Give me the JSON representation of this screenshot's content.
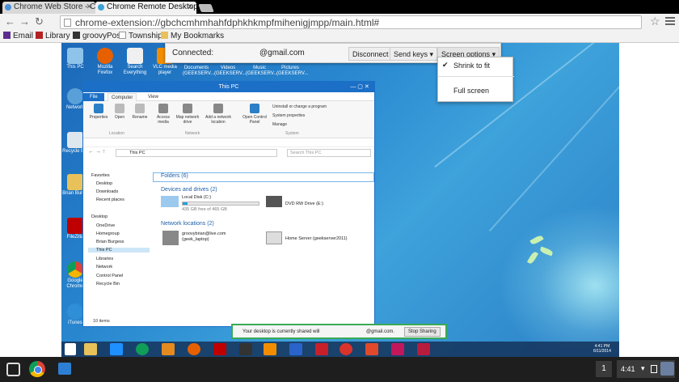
{
  "tabs": [
    {
      "title": "Chrome Web Store - Chr"
    },
    {
      "title": "Chrome Remote Desktop"
    }
  ],
  "address": {
    "url": "chrome-extension://gbchcmhmhahfdphkhkmpfmihenigjmpp/main.html#"
  },
  "bookmarks": [
    {
      "label": "Email"
    },
    {
      "label": "Library"
    },
    {
      "label": "groovyPost"
    },
    {
      "label": "Township"
    },
    {
      "label": "My Bookmarks"
    }
  ],
  "connect_bar": {
    "connected_label": "Connected:",
    "email": "@gmail.com",
    "disconnect": "Disconnect",
    "send_keys": "Send keys",
    "screen_options": "Screen options"
  },
  "screen_menu": {
    "shrink": "Shrink to fit",
    "full": "Full screen"
  },
  "desktop_icons": [
    {
      "label": "This PC"
    },
    {
      "label": "Mozilla Firefox"
    },
    {
      "label": "Search Everything"
    },
    {
      "label": "VLC media player"
    },
    {
      "label": "Documents (GEEKSERV..."
    },
    {
      "label": "Videos (GEEKSERV..."
    },
    {
      "label": "Music (GEEKSERV..."
    },
    {
      "label": "Pictures (GEEKSERV..."
    },
    {
      "label": "Network"
    },
    {
      "label": "Recycle Bin"
    },
    {
      "label": "Brian Burge"
    },
    {
      "label": "FileZilla"
    },
    {
      "label": "Google Chrome"
    },
    {
      "label": "iTunes"
    }
  ],
  "explorer": {
    "title": "This PC",
    "tabs": {
      "file": "File",
      "computer": "Computer",
      "view": "View"
    },
    "ribbon": {
      "properties": "Properties",
      "open": "Open",
      "rename": "Rename",
      "access_media": "Access media",
      "map_drive": "Map network drive",
      "add_location": "Add a network location",
      "open_cp": "Open Control Panel",
      "uninstall": "Uninstall or change a program",
      "sysprops": "System properties",
      "manage": "Manage",
      "grp_location": "Location",
      "grp_network": "Network",
      "grp_system": "System"
    },
    "address": "This PC",
    "search_placeholder": "Search This PC",
    "nav": [
      "Favorites",
      "Desktop",
      "Downloads",
      "Recent places",
      "Desktop",
      "OneDrive",
      "Homegroup",
      "Brian Burgess",
      "This PC",
      "Libraries",
      "Network",
      "Control Panel",
      "Recycle Bin"
    ],
    "folders": "Folders (6)",
    "devices_header": "Devices and drives (2)",
    "local_disk": {
      "name": "Local Disk (C:)",
      "free": "435 GB free of 465 GB",
      "used_fraction": 0.065
    },
    "dvd": "DVD RW Drive (E:)",
    "netloc_header": "Network locations (2)",
    "netloc1": {
      "line1": "groovybrian@live.com",
      "line2": "(geek_laptop)"
    },
    "netloc2": "Home Server (geekserver2011)",
    "status": "10 items"
  },
  "share_bar": {
    "text": "Your desktop is currently shared will",
    "email": "@gmail.com.",
    "stop": "Stop Sharing"
  },
  "win_clock": {
    "time": "4:41 PM",
    "date": "6/11/2014"
  },
  "shelf": {
    "workspace": "1",
    "time": "4:41"
  }
}
